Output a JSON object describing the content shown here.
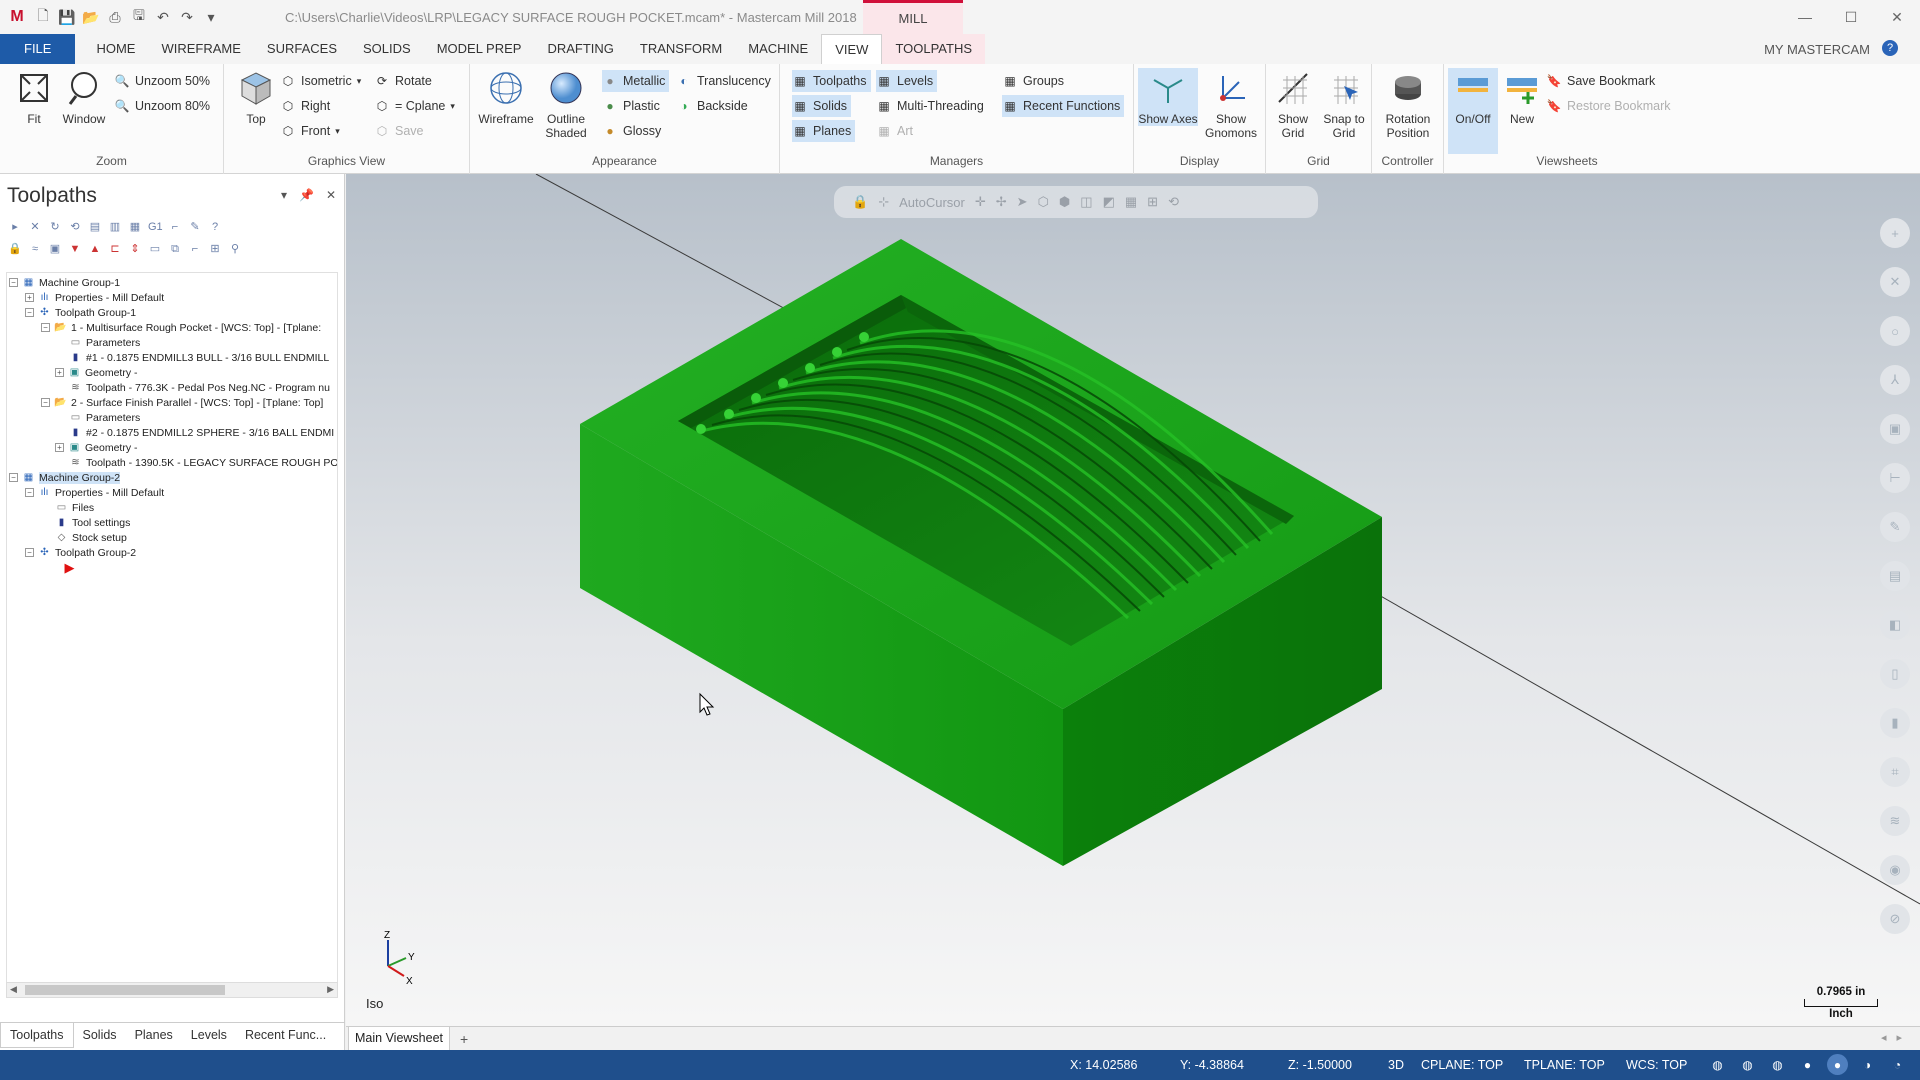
{
  "window": {
    "title": "C:\\Users\\Charlie\\Videos\\LRP\\LEGACY SURFACE ROUGH POCKET.mcam* - Mastercam Mill 2018",
    "context_tab": "MILL",
    "minimize": "—",
    "maximize": "☐",
    "close": "✕"
  },
  "tabs": [
    "FILE",
    "HOME",
    "WIREFRAME",
    "SURFACES",
    "SOLIDS",
    "MODEL PREP",
    "DRAFTING",
    "TRANSFORM",
    "MACHINE",
    "VIEW",
    "TOOLPATHS"
  ],
  "my_mastercam": "MY MASTERCAM",
  "ribbon": {
    "zoom": {
      "label": "Zoom",
      "fit": "Fit",
      "window": "Window",
      "unzoom50": "Unzoom 50%",
      "unzoom80": "Unzoom 80%"
    },
    "graphics_view": {
      "label": "Graphics View",
      "top": "Top",
      "isometric": "Isometric",
      "right": "Right",
      "front": "Front",
      "rotate": "Rotate",
      "cplane": "= Cplane",
      "save": "Save"
    },
    "appearance": {
      "label": "Appearance",
      "wireframe": "Wireframe",
      "outline_shaded": "Outline Shaded",
      "metallic": "Metallic",
      "plastic": "Plastic",
      "glossy": "Glossy",
      "translucency": "Translucency",
      "backside": "Backside"
    },
    "managers": {
      "label": "Managers",
      "toolpaths": "Toolpaths",
      "solids": "Solids",
      "planes": "Planes",
      "levels": "Levels",
      "multi_threading": "Multi-Threading",
      "art": "Art",
      "groups": "Groups",
      "recent_functions": "Recent Functions"
    },
    "display": {
      "label": "Display",
      "show_axes": "Show Axes",
      "show_gnomons": "Show Gnomons"
    },
    "grid": {
      "label": "Grid",
      "show_grid": "Show Grid",
      "snap_to_grid": "Snap to Grid"
    },
    "controller": {
      "label": "Controller",
      "rotation_position": "Rotation Position"
    },
    "viewsheets": {
      "label": "Viewsheets",
      "on_off": "On/Off",
      "new": "New",
      "save_bookmark": "Save Bookmark",
      "restore_bookmark": "Restore Bookmark"
    }
  },
  "panel": {
    "title": "Toolpaths",
    "tree": [
      "Machine Group-1",
      "Properties - Mill Default",
      "Toolpath Group-1",
      "1 - Multisurface Rough Pocket - [WCS: Top] - [Tplane: ",
      "Parameters",
      "#1 - 0.1875 ENDMILL3 BULL - 3/16 BULL ENDMILL ",
      "Geometry -",
      "Toolpath - 776.3K - Pedal Pos Neg.NC - Program nu",
      "2 - Surface Finish Parallel - [WCS: Top] - [Tplane: Top]",
      "Parameters",
      "#2 - 0.1875 ENDMILL2 SPHERE - 3/16 BALL ENDMI",
      "Geometry -",
      "Toolpath - 1390.5K - LEGACY SURFACE ROUGH PO",
      "Machine Group-2",
      "Properties - Mill Default",
      "Files",
      "Tool settings",
      "Stock setup",
      "Toolpath Group-2"
    ],
    "bottom_tabs": [
      "Toolpaths",
      "Solids",
      "Planes",
      "Levels",
      "Recent Func..."
    ]
  },
  "viewport": {
    "autocursor": "AutoCursor",
    "view_name": "Iso",
    "scale_value": "0.7965 in",
    "scale_unit": "Inch",
    "axis_x": "X",
    "axis_y": "Y",
    "axis_z": "Z",
    "part_color": "#1aa51a"
  },
  "viewsheet_tab": "Main Viewsheet",
  "status": {
    "x": "X:  14.02586",
    "y": "Y:  -4.38864",
    "z": "Z:  -1.50000",
    "mode": "3D",
    "cplane": "CPLANE: TOP",
    "tplane": "TPLANE: TOP",
    "wcs": "WCS: TOP"
  }
}
